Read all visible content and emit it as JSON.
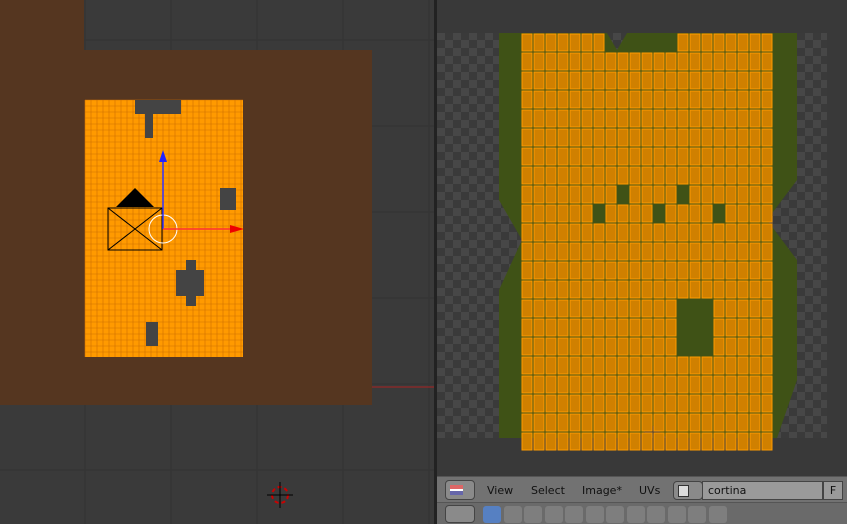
{
  "uv_header": {
    "menus": [
      "View",
      "Select",
      "Image*",
      "UVs"
    ],
    "image_name": "cortina",
    "fake_user": "F"
  },
  "properties_tabs": [
    "render",
    "render-layers",
    "scene",
    "world",
    "object",
    "constraints",
    "modifiers",
    "data",
    "material",
    "texture",
    "particles",
    "physics"
  ],
  "colors": {
    "mesh": "#ff9a00",
    "ground": "#553620",
    "uv_image": "#3f5216",
    "bg": "#393939"
  }
}
